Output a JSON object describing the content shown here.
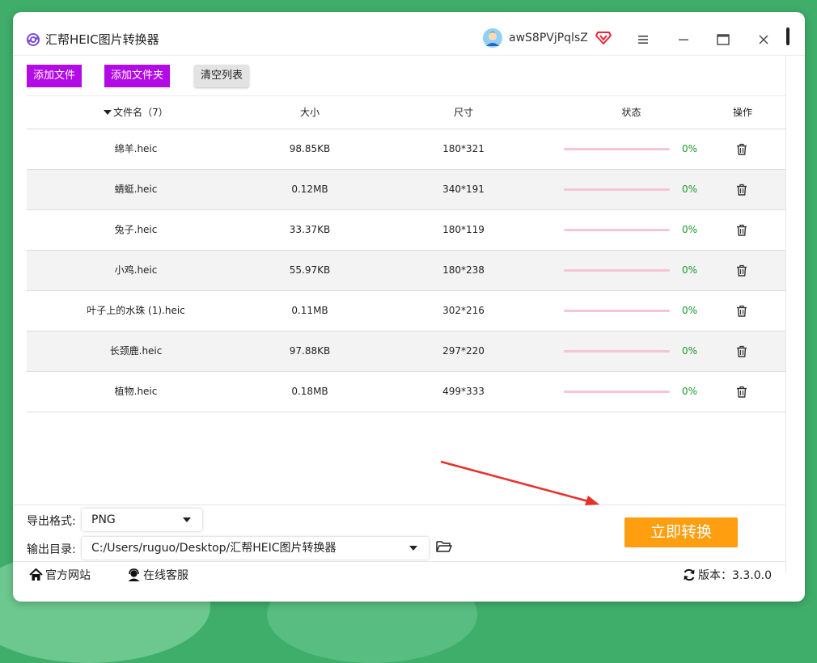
{
  "app": {
    "title": "汇帮HEIC图片转换器",
    "username": "awS8PVjPqlsZ"
  },
  "toolbar": {
    "add_files": "添加文件",
    "add_folder": "添加文件夹",
    "clear_list": "清空列表"
  },
  "table": {
    "headers": {
      "name": "文件名（7）",
      "size": "大小",
      "dimensions": "尺寸",
      "status": "状态",
      "actions": "操作"
    },
    "rows": [
      {
        "name": "绵羊.heic",
        "size": "98.85KB",
        "dimensions": "180*321",
        "progress": 0,
        "status": "0%"
      },
      {
        "name": "蜻蜓.heic",
        "size": "0.12MB",
        "dimensions": "340*191",
        "progress": 0,
        "status": "0%"
      },
      {
        "name": "兔子.heic",
        "size": "33.37KB",
        "dimensions": "180*119",
        "progress": 0,
        "status": "0%"
      },
      {
        "name": "小鸡.heic",
        "size": "55.97KB",
        "dimensions": "180*238",
        "progress": 0,
        "status": "0%"
      },
      {
        "name": "叶子上的水珠 (1).heic",
        "size": "0.11MB",
        "dimensions": "302*216",
        "progress": 0,
        "status": "0%"
      },
      {
        "name": "长颈鹿.heic",
        "size": "97.88KB",
        "dimensions": "297*220",
        "progress": 0,
        "status": "0%"
      },
      {
        "name": "植物.heic",
        "size": "0.18MB",
        "dimensions": "499*333",
        "progress": 0,
        "status": "0%"
      }
    ]
  },
  "output": {
    "format_label": "导出格式:",
    "format_value": "PNG",
    "dir_label": "输出目录:",
    "dir_value": "C:/Users/ruguo/Desktop/汇帮HEIC图片转换器"
  },
  "convert_button": "立即转换",
  "footer": {
    "website": "官方网站",
    "support": "在线客服",
    "version": "版本：3.3.0.0"
  },
  "colors": {
    "accent_purple": "#b30be6",
    "convert_orange": "#ff9e0f",
    "progress_track": "#f5c5d5",
    "status_green": "#1a9a2a"
  }
}
